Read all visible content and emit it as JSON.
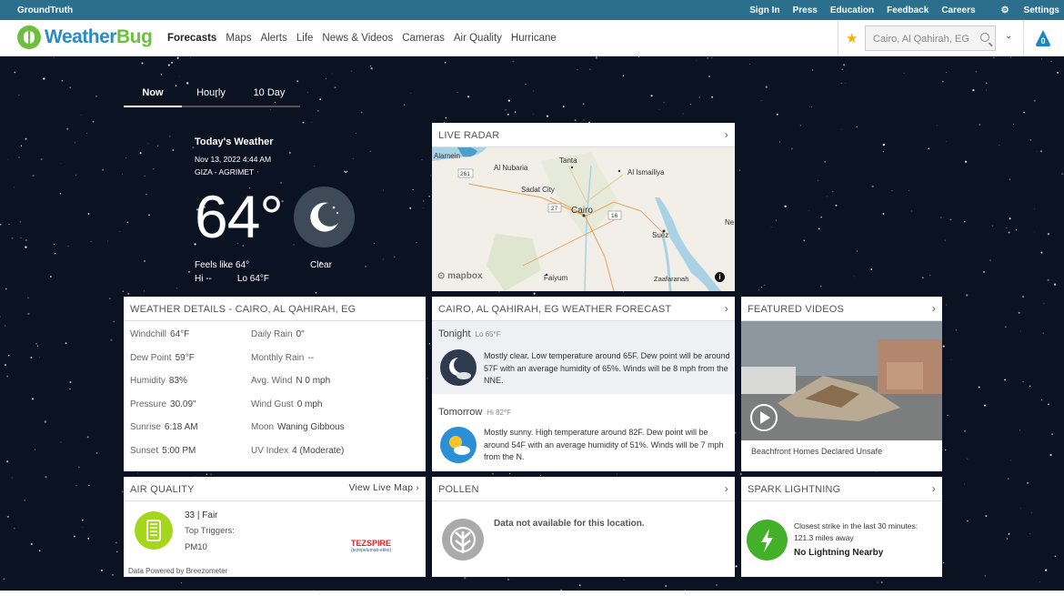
{
  "topbar": {
    "brand": "GroundTruth",
    "links": [
      "Sign In",
      "Press",
      "Education",
      "Feedback",
      "Careers",
      "Settings"
    ]
  },
  "header": {
    "logo_text_1": "Weather",
    "logo_text_2": "Bug",
    "nav": [
      {
        "label": "Forecasts",
        "active": true
      },
      {
        "label": "Maps"
      },
      {
        "label": "Alerts"
      },
      {
        "label": "Life"
      },
      {
        "label": "News & Videos"
      },
      {
        "label": "Cameras"
      },
      {
        "label": "Air Quality"
      },
      {
        "label": "Hurricane"
      }
    ],
    "search_value": "Cairo, Al Qahirah, EG",
    "alert_count": "0",
    "colors": {
      "topbar": "#2b6f8c",
      "logo_blue": "#2a8bc2",
      "logo_green": "#6cbf3f"
    }
  },
  "tabs": [
    {
      "label": "Now",
      "active": true
    },
    {
      "label": "Hourly"
    },
    {
      "label": "10 Day"
    }
  ],
  "now": {
    "title": "Today's Weather",
    "date": "Nov 13, 2022 4:44 AM",
    "station": "GIZA - AGRIMET",
    "temp": "64°",
    "feels_like": "Feels like 64°",
    "condition": "Clear",
    "hi": "Hi --",
    "lo": "Lo 64°F"
  },
  "radar": {
    "title": "LIVE RADAR",
    "attribution": "mapbox",
    "labels": [
      {
        "name": "Alamein"
      },
      {
        "name": "261"
      },
      {
        "name": "Al Nubaria"
      },
      {
        "name": "Tanta"
      },
      {
        "name": "Al Ismailiya"
      },
      {
        "name": "Sadat City"
      },
      {
        "name": "27"
      },
      {
        "name": "Cairo"
      },
      {
        "name": "16"
      },
      {
        "name": "Suez"
      },
      {
        "name": "Ne"
      },
      {
        "name": "Faiyum"
      },
      {
        "name": "Zaafaranah"
      }
    ]
  },
  "details": {
    "title": "WEATHER DETAILS - CAIRO, AL QAHIRAH, EG",
    "rows": [
      {
        "l_label": "Windchill",
        "l_value": "64°F",
        "r_label": "Daily Rain",
        "r_value": "0\""
      },
      {
        "l_label": "Dew Point",
        "l_value": "59°F",
        "r_label": "Monthly Rain",
        "r_value": "--"
      },
      {
        "l_label": "Humidity",
        "l_value": "83%",
        "r_label": "Avg. Wind",
        "r_value": "N 0 mph"
      },
      {
        "l_label": "Pressure",
        "l_value": "30.09\"",
        "r_label": "Wind Gust",
        "r_value": "0 mph"
      },
      {
        "l_label": "Sunrise",
        "l_value": "6:18 AM",
        "r_label": "Moon",
        "r_value": "Waning Gibbous"
      },
      {
        "l_label": "Sunset",
        "l_value": "5:00 PM",
        "r_label": "UV Index",
        "r_value": "4 (Moderate)"
      }
    ]
  },
  "forecast": {
    "title": "CAIRO, AL QAHIRAH, EG WEATHER FORECAST",
    "periods": [
      {
        "name": "Tonight",
        "temp": "Lo 65°F",
        "text": "Mostly clear. Low temperature around 65F. Dew point will be around 57F with an average humidity of 65%. Winds will be 8 mph from the NNE."
      },
      {
        "name": "Tomorrow",
        "temp": "Hi 82°F",
        "text": "Mostly sunny. High temperature around 82F. Dew point will be around 54F with an average humidity of 51%. Winds will be 7 mph from the N."
      }
    ]
  },
  "videos": {
    "title": "FEATURED VIDEOS",
    "caption": "Beachfront Homes Declared Unsafe"
  },
  "air_quality": {
    "title": "AIR QUALITY",
    "link": "View Live Map",
    "value": "33 | Fair",
    "triggers_label": "Top Triggers:",
    "trigger": "PM10",
    "credit": "Data Powered by Breezometer",
    "sponsor": "TEZSPIRE",
    "sponsor_sub": "(tezepelumab-ekko)"
  },
  "pollen": {
    "title": "POLLEN",
    "message": "Data not available for this location."
  },
  "spark": {
    "title": "SPARK LIGHTNING",
    "line1": "Closest strike in the last 30 minutes:",
    "line2": "121.3 miles away",
    "line3": "No Lightning Nearby"
  }
}
